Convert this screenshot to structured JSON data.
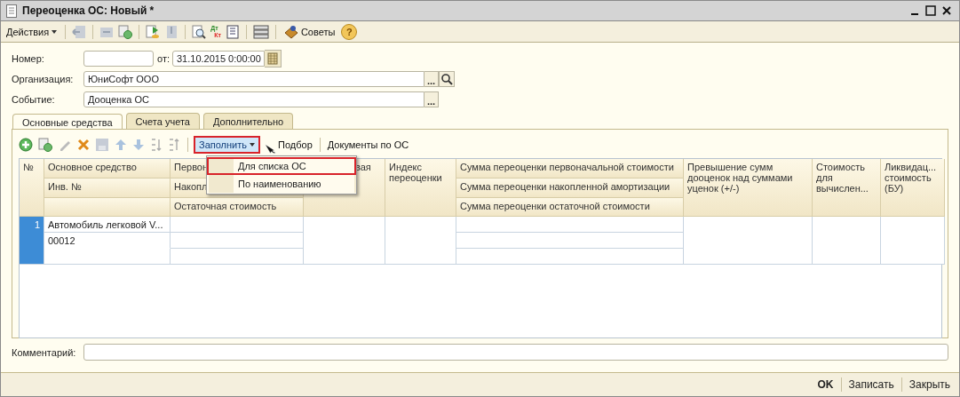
{
  "window": {
    "title": "Переоценка ОС: Новый *"
  },
  "toolbar": {
    "actions": "Действия",
    "tips": "Советы",
    "dt": "Дт",
    "kt": "Кт",
    "help": "?"
  },
  "form": {
    "number_label": "Номер:",
    "date_label": "от:",
    "date": "31.10.2015  0:00:00",
    "organization_label": "Организация:",
    "organization": "ЮниСофт ООО",
    "event_label": "Событие:",
    "event": "Дооценка ОС",
    "ellipsis": "..."
  },
  "tabs": [
    {
      "label": "Основные средства",
      "selected": true
    },
    {
      "label": "Счета учета",
      "selected": false
    },
    {
      "label": "Дополнительно",
      "selected": false
    }
  ],
  "table_toolbar": {
    "fill": {
      "label": "Заполнить",
      "highlighted": true
    },
    "pick": "Подбор",
    "documents": "Документы по ОС"
  },
  "fill_menu": [
    {
      "label": "Для списка ОС",
      "highlighted": true
    },
    {
      "label": "По наименованию",
      "highlighted": false
    }
  ],
  "table": {
    "columns": [
      {
        "kind": "single",
        "header": "№"
      },
      {
        "kind": "stacked",
        "headers": [
          "Основное средство",
          "Инв. №"
        ]
      },
      {
        "kind": "stacked",
        "headers": [
          "Первон",
          "Накопл",
          "Остаточная стоимость"
        ]
      },
      {
        "kind": "single",
        "header": "вая"
      },
      {
        "kind": "single",
        "header": "Индекс переоценки"
      },
      {
        "kind": "stacked",
        "headers": [
          "Сумма переоценки первоначальной стоимости",
          "Сумма переоценки накопленной амортизации",
          "Сумма переоценки остаточной стоимости"
        ]
      },
      {
        "kind": "single",
        "header": "Превышение сумм дооценок над суммами уценок (+/-)"
      },
      {
        "kind": "single",
        "header": "Стоимость для вычислен..."
      },
      {
        "kind": "single",
        "header": "Ликвидац... стоимость (БУ)"
      }
    ],
    "rows": [
      {
        "number": "1",
        "selected": true,
        "asset": "Автомобиль легковой V...",
        "inventory_number": "00012"
      }
    ]
  },
  "comment": {
    "label": "Комментарий:"
  },
  "footer": {
    "ok": "OK",
    "save": "Записать",
    "close": "Закрыть"
  }
}
